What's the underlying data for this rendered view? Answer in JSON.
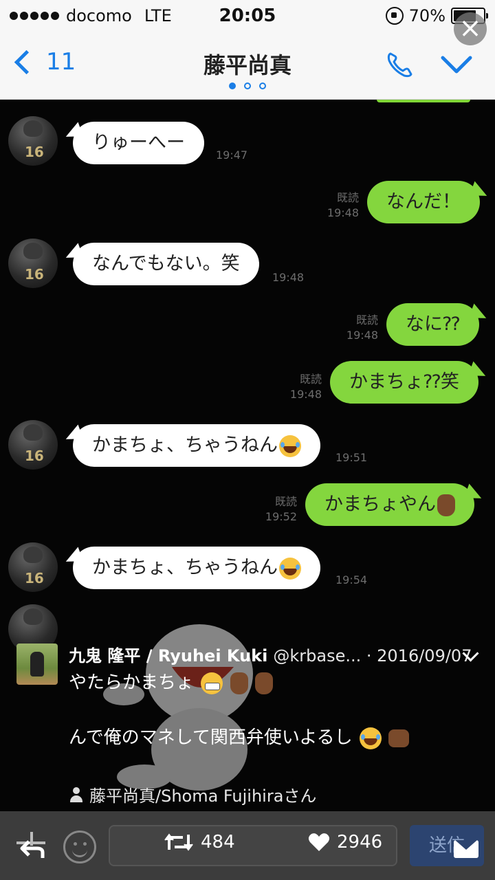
{
  "status_bar": {
    "carrier": "docomo",
    "network": "LTE",
    "time": "20:05",
    "battery": "70%"
  },
  "navbar": {
    "back_count": "11",
    "title": "藤平尚真",
    "page_dots": 3,
    "active_dot": 0
  },
  "messages": [
    {
      "dir": "in",
      "text": "りゅーへー",
      "time": "19:47"
    },
    {
      "dir": "out",
      "text": "なんだ！",
      "read": "既読",
      "time": "19:48"
    },
    {
      "dir": "in",
      "text": "なんでもない。笑",
      "time": "19:48"
    },
    {
      "dir": "out",
      "text": "なに⁇",
      "read": "既読",
      "time": "19:48"
    },
    {
      "dir": "out",
      "text": "かまちょ⁇笑",
      "read": "既読",
      "time": "19:48"
    },
    {
      "dir": "in",
      "text": "かまちょ、ちゃうねん",
      "emoji": "laugh-cry-icon",
      "time": "19:51"
    },
    {
      "dir": "out",
      "text": "かまちょやん",
      "emoji": "raised-hand-icon",
      "read": "既読",
      "time": "19:52"
    },
    {
      "dir": "in",
      "text": "かまちょ、ちゃうねん",
      "emoji": "laugh-cry-icon",
      "time": "19:54"
    }
  ],
  "tweet": {
    "name": "九鬼 隆平 / Ryuhei Kuki",
    "handle": "@krbase...",
    "date": "· 2016/09/07",
    "line1": "やたらかまちょ",
    "line2": "んで俺のマネして関西弁使いよるし",
    "mention": "藤平尚真/Shoma Fujihiraさん"
  },
  "actions": {
    "retweets": "484",
    "likes": "2946",
    "send_label": "送信"
  },
  "colors": {
    "bubble_out": "#84d63e",
    "bubble_in": "#ffffff",
    "accent": "#1a7ee6",
    "chat_bg": "#050505"
  }
}
